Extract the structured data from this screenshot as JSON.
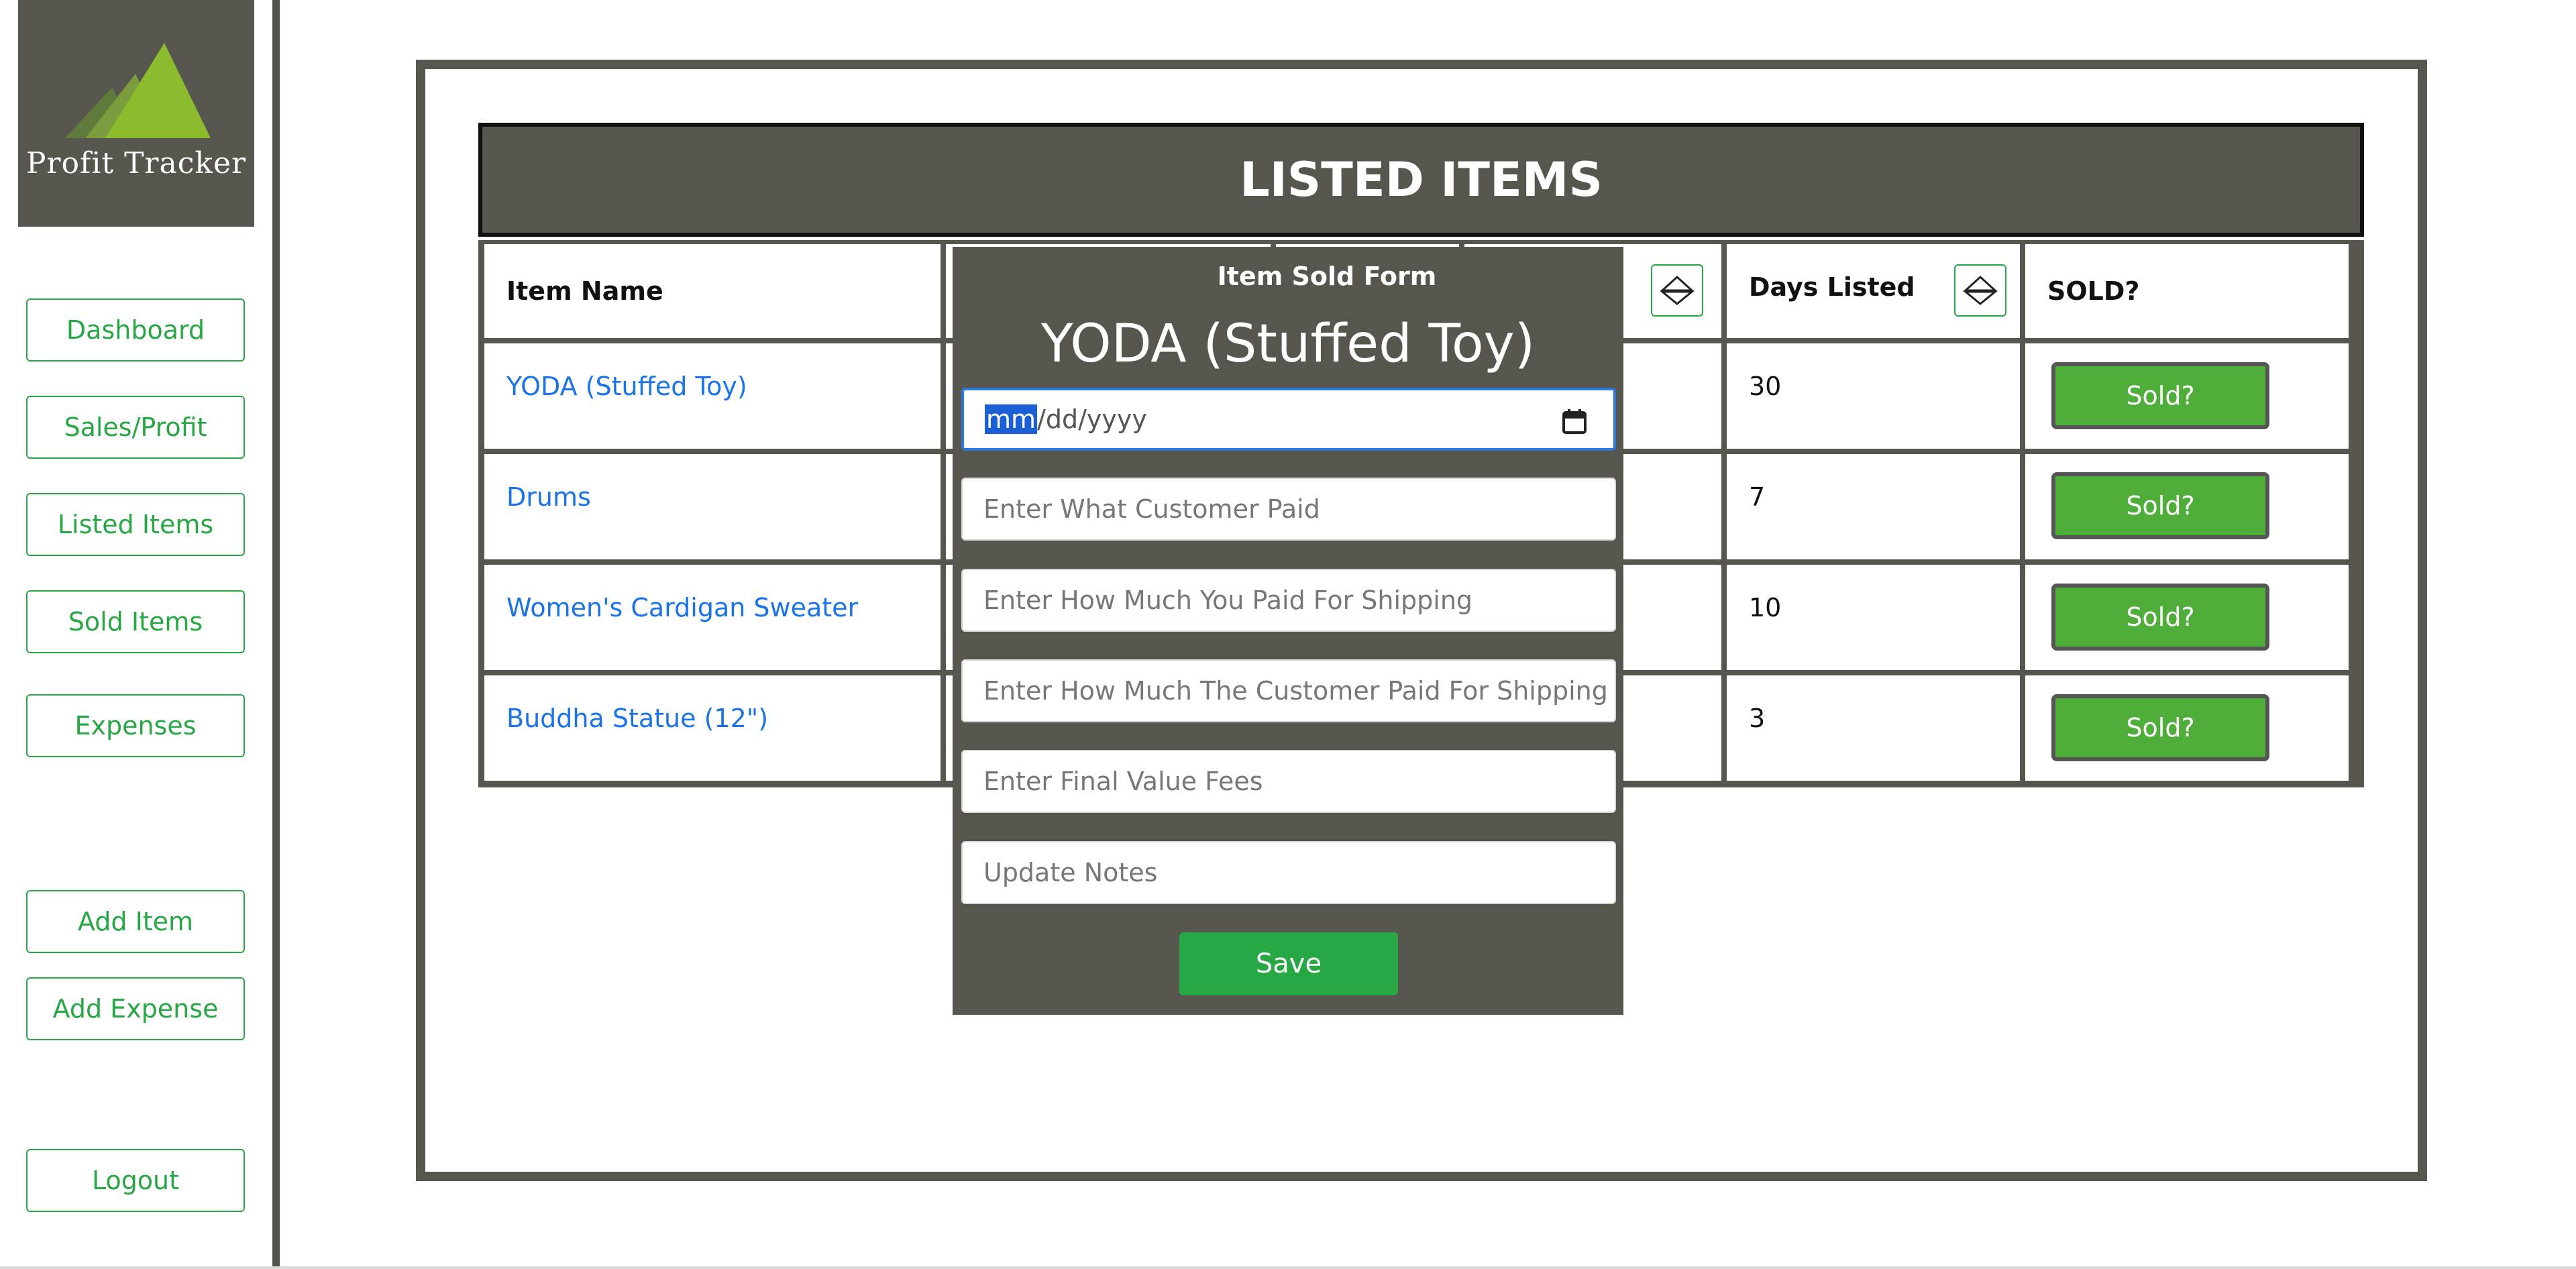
{
  "app": {
    "logo_text": "Profit Tracker"
  },
  "sidebar": {
    "nav": [
      "Dashboard",
      "Sales/Profit",
      "Listed Items",
      "Sold Items",
      "Expenses"
    ],
    "actions": [
      "Add Item",
      "Add Expense"
    ],
    "logout": "Logout"
  },
  "table": {
    "title": "LISTED ITEMS",
    "headers": {
      "item_name": "Item Name",
      "days_listed": "Days Listed",
      "sold": "SOLD?"
    },
    "rows": [
      {
        "name": "YODA (Stuffed Toy)",
        "days": "30",
        "sold_label": "Sold?"
      },
      {
        "name": "Drums",
        "days": "7",
        "sold_label": "Sold?"
      },
      {
        "name": "Women's Cardigan Sweater",
        "days": "10",
        "sold_label": "Sold?"
      },
      {
        "name": "Buddha Statue (12\")",
        "days": "3",
        "sold_label": "Sold?"
      }
    ]
  },
  "modal": {
    "label": "Item Sold Form",
    "item_title": "YODA (Stuffed Toy)",
    "date_segment": "mm",
    "date_rest": "/dd/yyyy",
    "placeholders": {
      "customer_paid": "Enter What Customer Paid",
      "you_paid_shipping": "Enter How Much You Paid For Shipping",
      "customer_paid_shipping": "Enter How Much The Customer Paid For Shipping",
      "final_value_fees": "Enter Final Value Fees",
      "notes": "Update Notes"
    },
    "save_label": "Save"
  },
  "colors": {
    "panel": "#56564f",
    "accent_green": "#28a745",
    "sold_green": "#4fae3a",
    "link_blue": "#1a73e8"
  }
}
